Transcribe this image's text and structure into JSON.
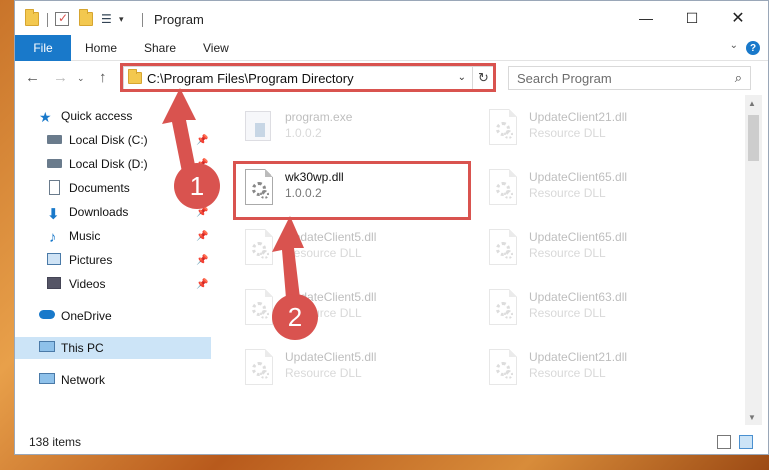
{
  "window": {
    "title": "Program"
  },
  "ribbon": {
    "tabs": [
      {
        "label": "File"
      },
      {
        "label": "Home"
      },
      {
        "label": "Share"
      },
      {
        "label": "View"
      }
    ],
    "help": "?",
    "expand": "⌄"
  },
  "nav": {
    "address": "C:\\Program Files\\Program Directory",
    "search_placeholder": "Search Program"
  },
  "sidebar": {
    "items": [
      {
        "label": "Quick access",
        "icon": "star-icon"
      },
      {
        "label": "Local Disk (C:)",
        "icon": "drive-icon"
      },
      {
        "label": "Local Disk (D:)",
        "icon": "drive-icon"
      },
      {
        "label": "Documents",
        "icon": "documents-icon"
      },
      {
        "label": "Downloads",
        "icon": "download-icon"
      },
      {
        "label": "Music",
        "icon": "music-icon"
      },
      {
        "label": "Pictures",
        "icon": "pictures-icon"
      },
      {
        "label": "Videos",
        "icon": "videos-icon"
      },
      {
        "label": "OneDrive",
        "icon": "cloud-icon"
      },
      {
        "label": "This PC",
        "icon": "computer-icon"
      },
      {
        "label": "Network",
        "icon": "network-icon"
      }
    ]
  },
  "files": [
    {
      "name": "program.exe",
      "sub": "1.0.0.2"
    },
    {
      "name": "UpdateClient21.dll",
      "sub": "Resource DLL"
    },
    {
      "name": "wk30wp.dll",
      "sub": "1.0.0.2"
    },
    {
      "name": "UpdateClient65.dll",
      "sub": "Resource DLL"
    },
    {
      "name": "UpdateClient5.dll",
      "sub": "Resource DLL"
    },
    {
      "name": "UpdateClient65.dll",
      "sub": "Resource DLL"
    },
    {
      "name": "UpdateClient5.dll",
      "sub": "Resource DLL"
    },
    {
      "name": "UpdateClient63.dll",
      "sub": "Resource DLL"
    },
    {
      "name": "UpdateClient5.dll",
      "sub": "Resource DLL"
    },
    {
      "name": "UpdateClient21.dll",
      "sub": "Resource DLL"
    }
  ],
  "status": {
    "items_count": "138 items"
  },
  "annotations": {
    "step1": "1",
    "step2": "2",
    "color": "#d9534f"
  },
  "colors": {
    "accent": "#1979ca",
    "selection": "#cce4f7"
  }
}
